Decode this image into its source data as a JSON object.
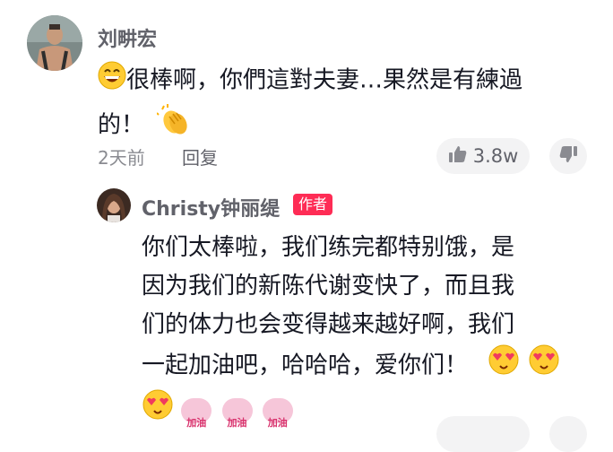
{
  "comment": {
    "username": "刘畊宏",
    "text_line1": "很棒啊，你們這對夫妻…果然是有練過",
    "text_line2": "的！",
    "time": "2天前",
    "reply_label": "回复",
    "like_count": "3.8w"
  },
  "reply": {
    "username": "Christy钟丽缇",
    "author_badge": "作者",
    "lines": [
      "你们太棒啦，我们练完都特别饿，是",
      "因为我们的新陈代谢变快了，而且我",
      "们的体力也会变得越来越好啊，我们",
      "一起加油吧，哈哈哈，爱你们！"
    ],
    "sticker_label": "加油"
  },
  "colors": {
    "accent": "#fe2c55",
    "text": "#161823",
    "secondary": "#8a8b91",
    "pill_bg": "#f3f3f4"
  },
  "icons": [
    "grinning-face-emoji",
    "clapping-hands-emoji",
    "thumbs-up-icon",
    "thumbs-down-icon",
    "heart-eyes-emoji",
    "jiayou-sticker"
  ]
}
